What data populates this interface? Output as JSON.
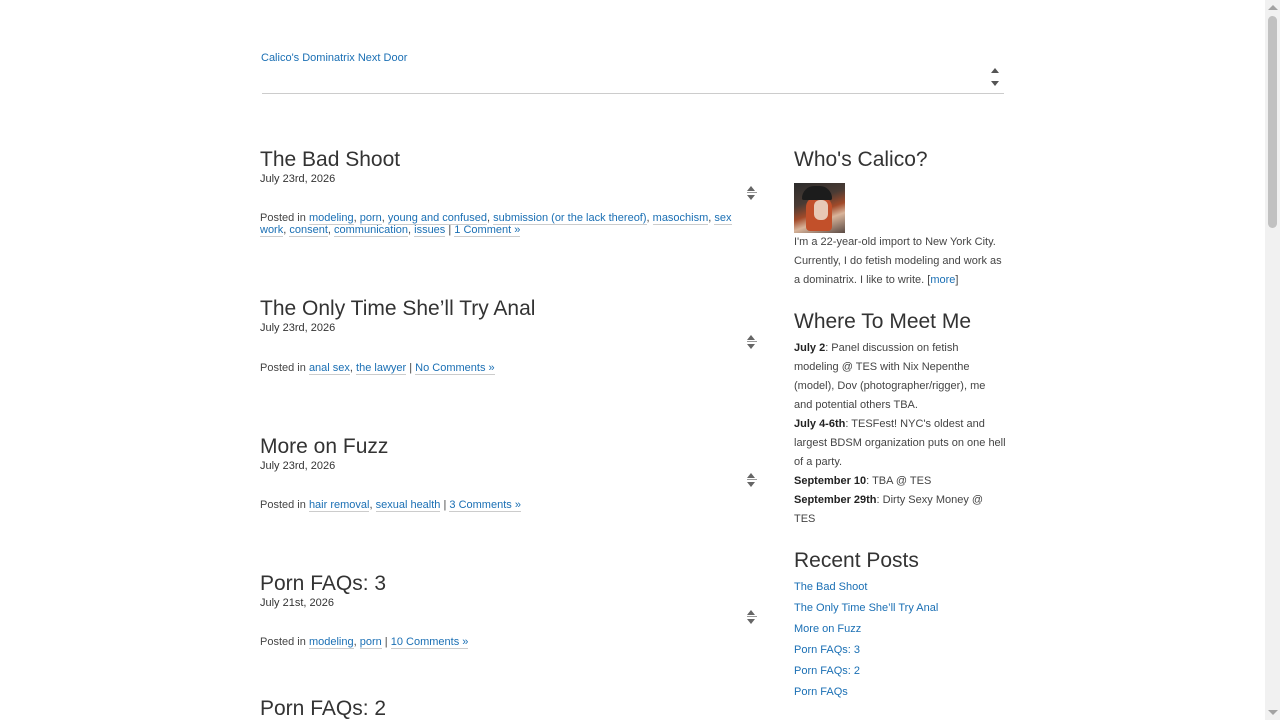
{
  "site": {
    "title": "Calico's Dominatrix Next Door"
  },
  "posts": [
    {
      "title": "The Bad Shoot",
      "date": "July 23rd, 2026",
      "posted_in": "Posted in",
      "categories": [
        "modeling",
        "porn",
        "young and confused",
        "submission (or the lack thereof)",
        "masochism",
        "sex work",
        "consent",
        "communication",
        "issues"
      ],
      "comments": "1 Comment »"
    },
    {
      "title": "The Only Time She’ll Try Anal",
      "date": "July 23rd, 2026",
      "posted_in": "Posted in",
      "categories": [
        "anal sex",
        "the lawyer"
      ],
      "comments": "No Comments »"
    },
    {
      "title": "More on Fuzz",
      "date": "July 23rd, 2026",
      "posted_in": "Posted in",
      "categories": [
        "hair removal",
        "sexual health"
      ],
      "comments": "3 Comments »"
    },
    {
      "title": "Porn FAQs: 3",
      "date": "July 21st, 2026",
      "posted_in": "Posted in",
      "categories": [
        "modeling",
        "porn"
      ],
      "comments": "10 Comments »"
    },
    {
      "title": "Porn FAQs: 2"
    }
  ],
  "sidebar": {
    "about": {
      "title": "Who's Calico?",
      "text": "I'm a 22-year-old import to New York City. Currently, I do fetish modeling and work as a dominatrix. I like to write. [",
      "more_link": "more",
      "text_end": "]"
    },
    "meet": {
      "title": "Where To Meet Me",
      "events": [
        {
          "date": "July 2",
          "text": ": Panel discussion on fetish modeling @ TES with Nix Nepenthe (model), Dov (photographer/rigger), me and potential others TBA."
        },
        {
          "date": "July 4-6th",
          "text": ": TESFest! NYC's oldest and largest BDSM organization puts on one hell of a party."
        },
        {
          "date": "September 10",
          "text": ": TBA @ TES"
        },
        {
          "date": "September 29th",
          "text": ": Dirty Sexy Money @ TES"
        }
      ]
    },
    "recent": {
      "title": "Recent Posts",
      "items": [
        "The Bad Shoot",
        "The Only Time She’ll Try Anal",
        "More on Fuzz",
        "Porn FAQs: 3",
        "Porn FAQs: 2",
        "Porn FAQs"
      ]
    }
  }
}
